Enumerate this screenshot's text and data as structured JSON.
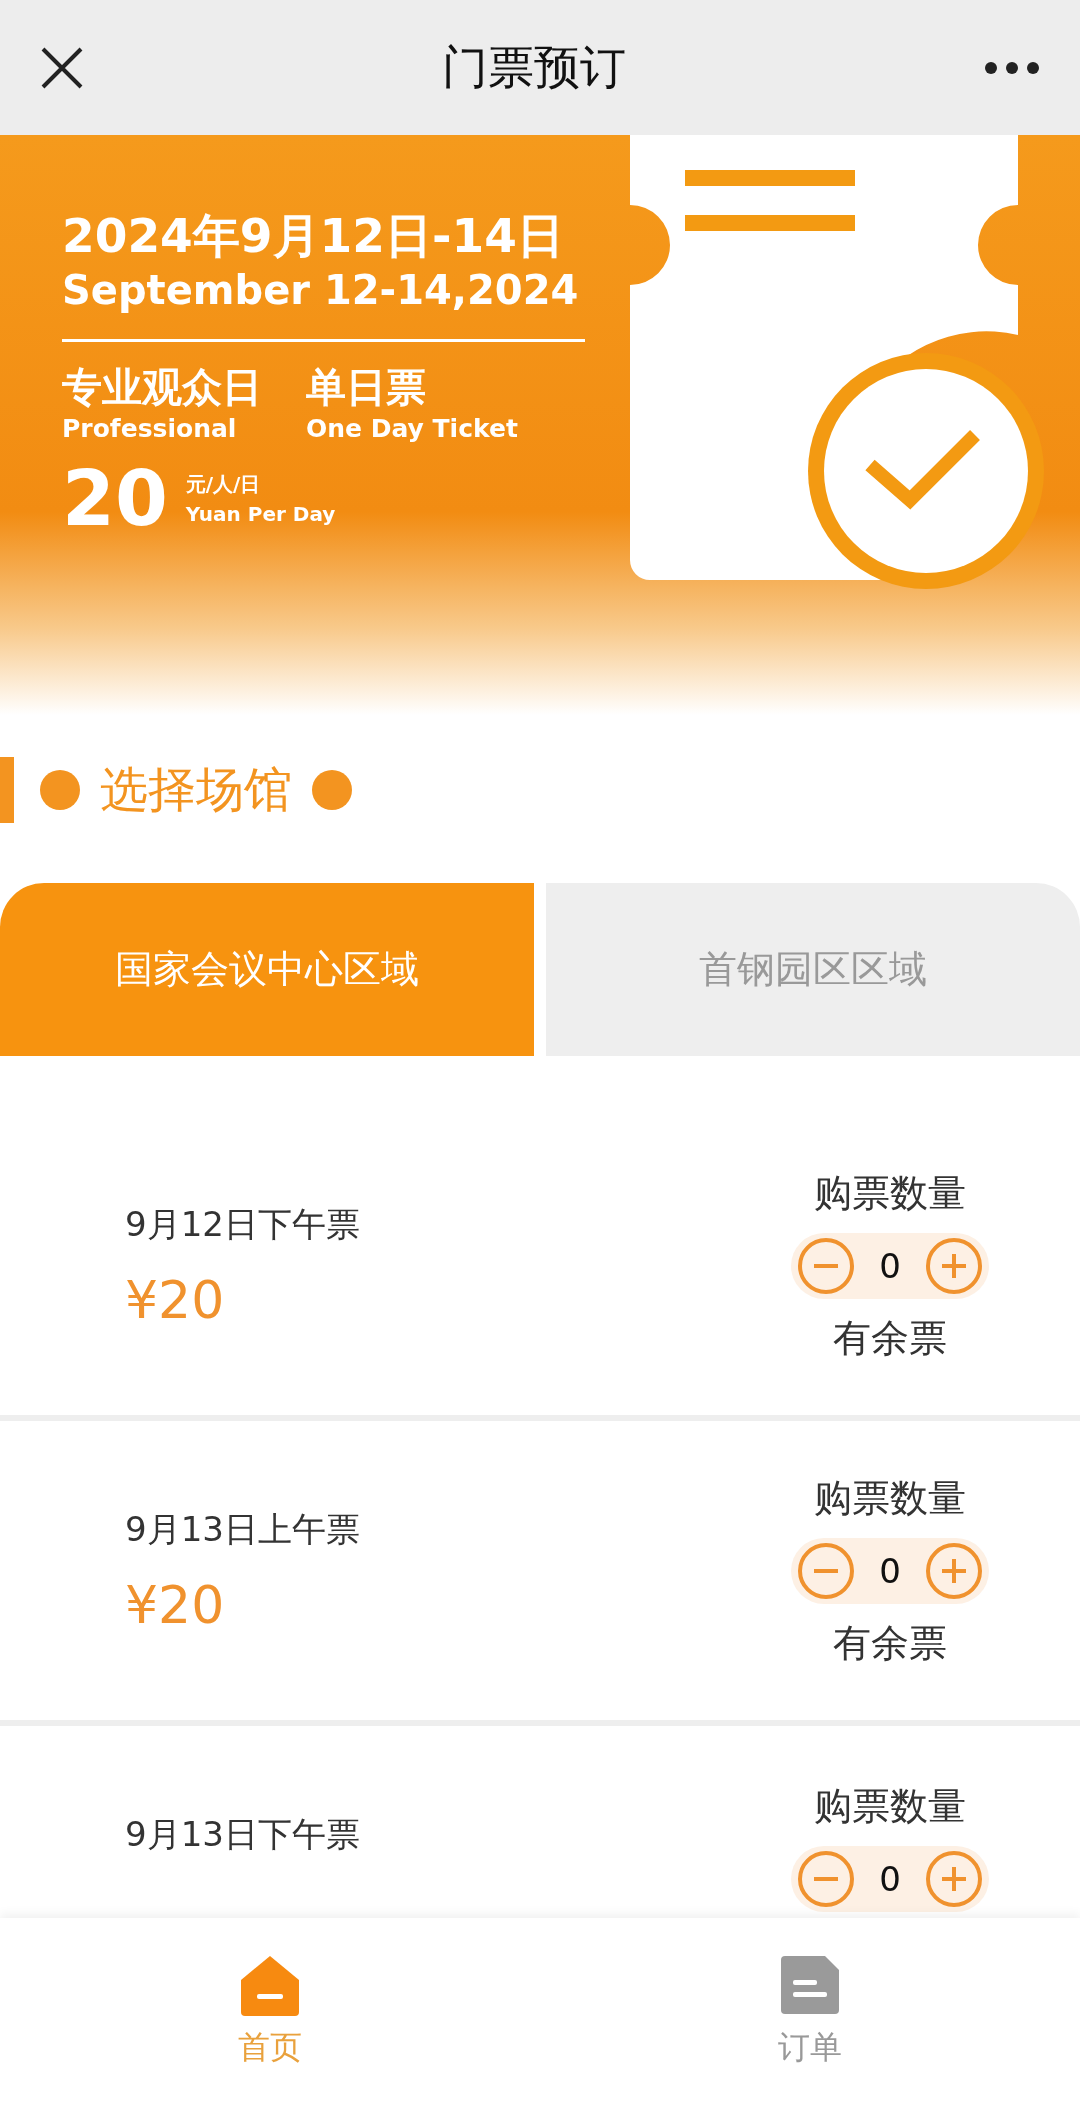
{
  "header": {
    "title": "门票预订"
  },
  "banner": {
    "date_cn": "2024年9月12日-14日",
    "date_en": "September 12-14,2024",
    "audience_cn": "专业观众日",
    "audience_en": "Professional",
    "ticket_cn": "单日票",
    "ticket_en": "One Day Ticket",
    "price": "20",
    "unit_cn": "元/人/日",
    "unit_en": "Yuan Per Day"
  },
  "section": {
    "title": "选择场馆"
  },
  "tabs": [
    {
      "label": "国家会议中心区域",
      "selected": true
    },
    {
      "label": "首钢园区区域",
      "selected": false
    }
  ],
  "tickets": [
    {
      "title": "9月12日下午票",
      "price": "¥20",
      "quantity_label": "购票数量",
      "quantity": "0",
      "stock": "有余票"
    },
    {
      "title": "9月13日上午票",
      "price": "¥20",
      "quantity_label": "购票数量",
      "quantity": "0",
      "stock": "有余票"
    },
    {
      "title": "9月13日下午票",
      "quantity_label": "购票数量",
      "quantity": "0"
    }
  ],
  "bottom_nav": [
    {
      "label": "首页",
      "kind": "home",
      "selected": true
    },
    {
      "label": "订单",
      "kind": "orders",
      "selected": false
    }
  ]
}
